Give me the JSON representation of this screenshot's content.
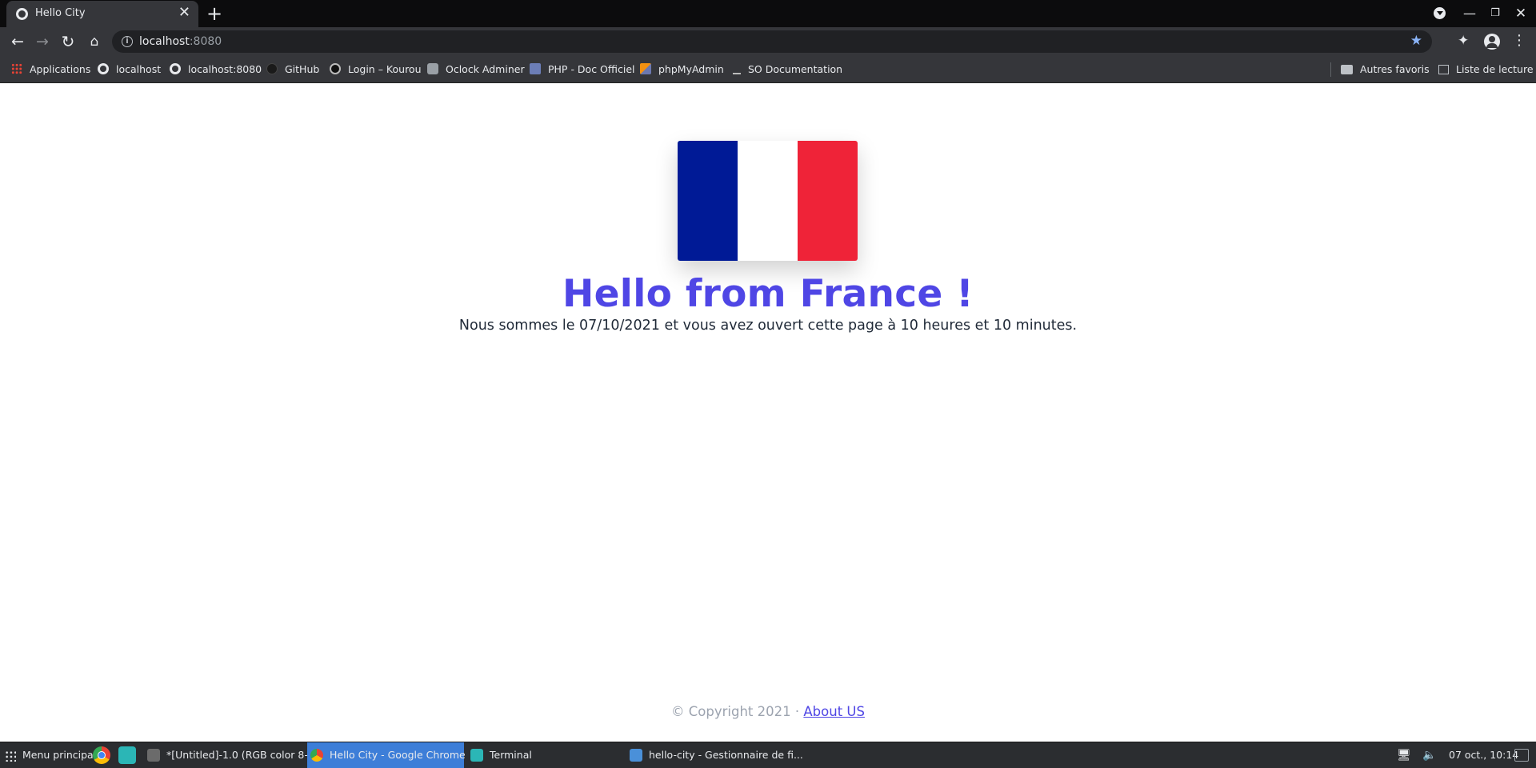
{
  "browser": {
    "tab": {
      "title": "Hello City",
      "close": "✕"
    },
    "new_tab": "+",
    "window_controls": {
      "profile": "",
      "minimize": "—",
      "maximize": "❐",
      "close": "✕"
    },
    "toolbar": {
      "back": "←",
      "forward": "→",
      "reload": "↻",
      "home": "⌂",
      "url_host": "localhost",
      "url_port": ":8080",
      "info_glyph": "i",
      "star": "★",
      "extensions": "✦",
      "menu": "⋮"
    },
    "bookmarks": [
      {
        "label": "Applications",
        "icon": "apps-grid-icon"
      },
      {
        "label": "localhost",
        "icon": "globe-icon"
      },
      {
        "label": "localhost:8080",
        "icon": "globe-icon"
      },
      {
        "label": "GitHub",
        "icon": "github-icon"
      },
      {
        "label": "Login – Kourou",
        "icon": "kourou-icon"
      },
      {
        "label": "Oclock Adminer",
        "icon": "adminer-icon"
      },
      {
        "label": "PHP - Doc Officiel",
        "icon": "php-icon"
      },
      {
        "label": "phpMyAdmin",
        "icon": "phpmyadmin-icon"
      },
      {
        "label": "SO Documentation",
        "icon": "stackoverflow-icon"
      }
    ],
    "other_bookmarks": "Autres favoris",
    "reading_list": "Liste de lecture"
  },
  "page": {
    "flag_colors": [
      "#001a96",
      "#ffffff",
      "#ef2338"
    ],
    "headline": "Hello from France !",
    "subline": "Nous sommes le 07/10/2021 et vous avez ouvert cette page à 10 heures et 10 minutes.",
    "footer": {
      "copyright": "© Copyright 2021 · ",
      "link": "About US"
    }
  },
  "taskbar": {
    "menu": "Menu principal",
    "windows": [
      "*[Untitled]-1.0 (RGB color 8-...",
      "Hello City - Google Chrome",
      "Terminal",
      "hello-city - Gestionnaire de fi..."
    ],
    "tray_network": "🖥",
    "tray_volume": "🔈",
    "clock": "07 oct., 10:14"
  }
}
